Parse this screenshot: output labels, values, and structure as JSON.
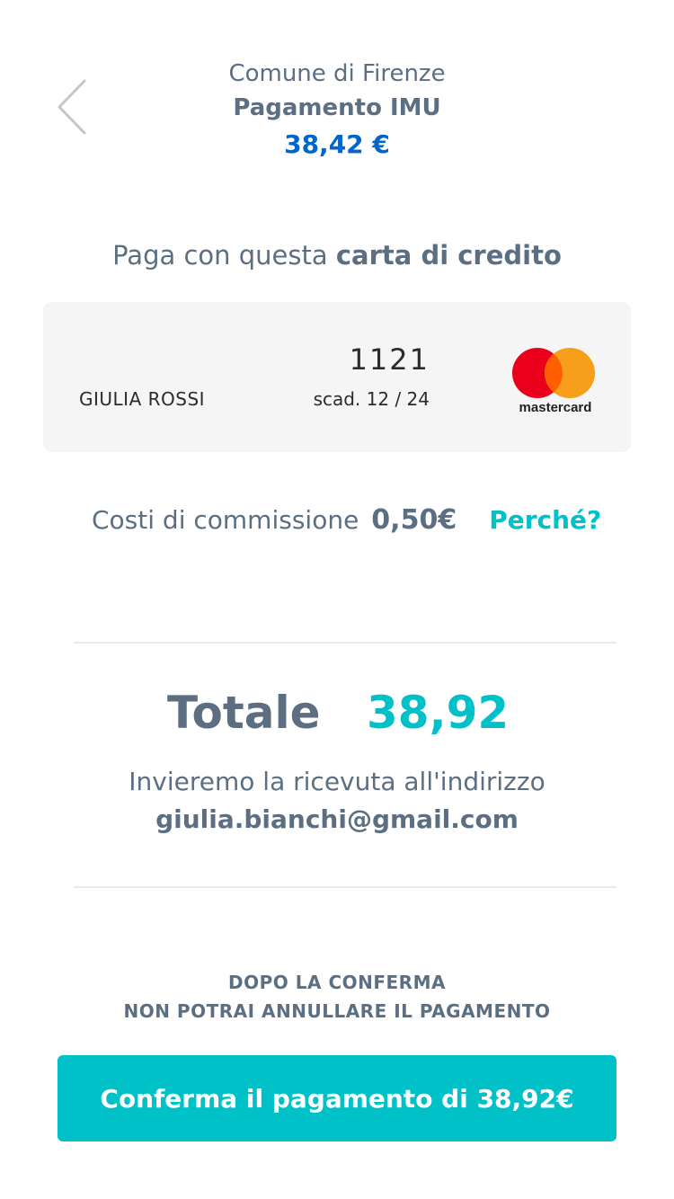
{
  "header": {
    "back_icon": "chevron-left-icon",
    "organization": "Comune di Firenze",
    "title": "Pagamento IMU",
    "amount": "38,42 €"
  },
  "payment_method": {
    "prefix": "Paga con questa ",
    "method": "carta di credito"
  },
  "card": {
    "holder": "GIULIA ROSSI",
    "last_digits": "1121",
    "expiry": "scad. 12 / 24",
    "brand": "mastercard",
    "brand_colors": {
      "red": "#eb001b",
      "yellow": "#f79e1b",
      "overlap": "#ff5f00"
    }
  },
  "fees": {
    "label": "Costi di commissione",
    "value": "0,50€",
    "why_link": "Perché?"
  },
  "total": {
    "label": "Totale",
    "value": "38,92"
  },
  "receipt": {
    "text": "Invieremo la ricevuta all'indirizzo",
    "email": "giulia.bianchi@gmail.com"
  },
  "warning": {
    "line1": "DOPO LA CONFERMA",
    "line2": "NON POTRAI ANNULLARE IL PAGAMENTO"
  },
  "confirm_button": {
    "label": "Conferma il pagamento di 38,92€"
  },
  "colors": {
    "text": "#5c6f82",
    "accent": "#00c1c8",
    "primary": "#0066cc",
    "card_bg": "#f5f5f5"
  }
}
